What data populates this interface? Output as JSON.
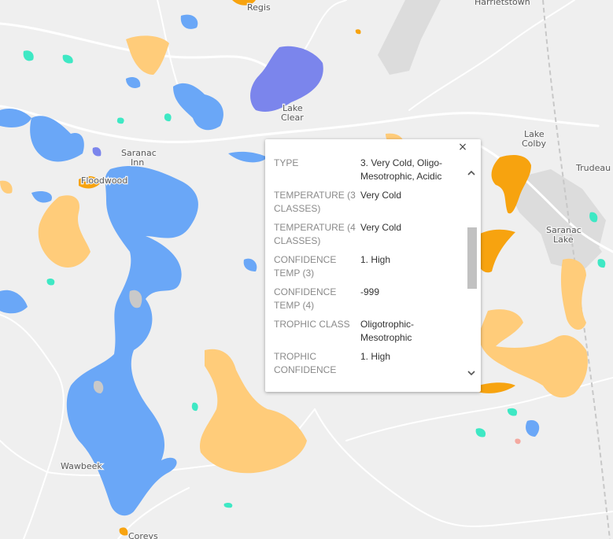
{
  "map": {
    "places": [
      {
        "id": "paul-smiths",
        "label": "Regis"
      },
      {
        "id": "harrietstown",
        "label": "Harrietstown"
      },
      {
        "id": "lake-clear-1",
        "label": "Lake"
      },
      {
        "id": "lake-clear-2",
        "label": "Clear"
      },
      {
        "id": "saranac-inn-1",
        "label": "Saranac"
      },
      {
        "id": "saranac-inn-2",
        "label": "Inn"
      },
      {
        "id": "floodwood",
        "label": "Floodwood"
      },
      {
        "id": "lake-colby-1",
        "label": "Lake"
      },
      {
        "id": "lake-colby-2",
        "label": "Colby"
      },
      {
        "id": "trudeau",
        "label": "Trudeau"
      },
      {
        "id": "saranac-lake-1",
        "label": "Saranac"
      },
      {
        "id": "saranac-lake-2",
        "label": "Lake"
      },
      {
        "id": "wawbeek",
        "label": "Wawbeek"
      },
      {
        "id": "coreys",
        "label": "Coreys"
      }
    ],
    "colors": {
      "background": "#efefef",
      "road": "#ffffff",
      "urban": "#dcdcdc",
      "very_cold_lake": "#6aa7f7",
      "purple_lake": "#7b85ec",
      "light_orange_lake": "#ffcc7a",
      "orange_lake": "#f7a30f",
      "teal_lake": "#3ee8c4"
    }
  },
  "popup": {
    "close_glyph": "×",
    "rows": [
      {
        "key": "TYPE",
        "value": "3. Very Cold, Oligo-Mesotrophic, Acidic"
      },
      {
        "key": "TEMPERATURE (3 CLASSES)",
        "value": "Very Cold"
      },
      {
        "key": "TEMPERATURE (4 CLASSES)",
        "value": "Very Cold"
      },
      {
        "key": "CONFIDENCE TEMP (3)",
        "value": "1. High"
      },
      {
        "key": "CONFIDENCE TEMP (4)",
        "value": "-999"
      },
      {
        "key": "TROPHIC CLASS",
        "value": "Oligotrophic-Mesotrophic"
      },
      {
        "key": "TROPHIC CONFIDENCE",
        "value": "1. High"
      }
    ]
  }
}
